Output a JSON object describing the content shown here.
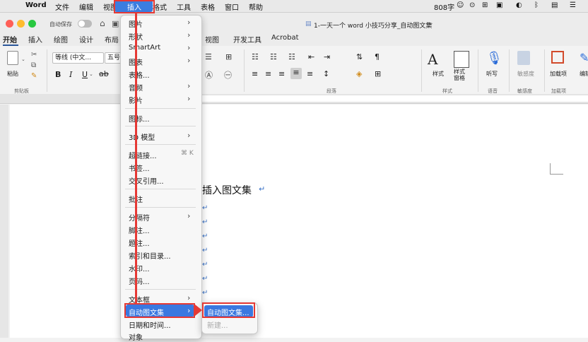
{
  "menubar": {
    "app": "Word",
    "items": [
      "文件",
      "编辑",
      "视图",
      "插入",
      "格式",
      "工具",
      "表格",
      "窗口",
      "帮助"
    ],
    "word_count": "808字"
  },
  "titlebar": {
    "autosave_label": "自动保存",
    "doc_title": "1-一天一个 word 小技巧分享_自动图文集"
  },
  "tabs": [
    "开始",
    "插入",
    "绘图",
    "设计",
    "布局",
    "视图",
    "开发工具",
    "Acrobat"
  ],
  "ribbon": {
    "paste": "粘贴",
    "clipboard_group": "剪贴板",
    "font_name": "等线 (中文...",
    "font_size": "五号",
    "paragraph_group": "段落",
    "styles": "样式",
    "styles_pane": "样式\n窗格",
    "styles_group": "样式",
    "dictate": "听写",
    "voice_group": "语音",
    "sensitivity": "敏感度",
    "sensitivity_group": "敏感度",
    "addins": "加载项",
    "addins_group": "加载项",
    "edit_partial": "编辑"
  },
  "insert_menu": {
    "items": [
      {
        "label": "图片",
        "submenu": true
      },
      {
        "label": "形状",
        "submenu": true
      },
      {
        "label": "SmartArt",
        "submenu": true
      },
      {
        "label": "图表",
        "submenu": true
      },
      {
        "label": "表格...",
        "submenu": false
      },
      {
        "label": "音频",
        "submenu": true
      },
      {
        "label": "影片",
        "submenu": true
      },
      {
        "label": "图标...",
        "submenu": false
      },
      {
        "label": "3D 模型",
        "submenu": true
      },
      {
        "label": "超链接...",
        "submenu": false,
        "shortcut": "⌘ K"
      },
      {
        "label": "书签...",
        "submenu": false
      },
      {
        "label": "交叉引用...",
        "submenu": false
      },
      {
        "label": "批注",
        "submenu": false
      },
      {
        "label": "分隔符",
        "submenu": true
      },
      {
        "label": "脚注...",
        "submenu": false
      },
      {
        "label": "题注...",
        "submenu": false
      },
      {
        "label": "索引和目录...",
        "submenu": false
      },
      {
        "label": "水印...",
        "submenu": false
      },
      {
        "label": "页码...",
        "submenu": false
      },
      {
        "label": "文本框",
        "submenu": true
      },
      {
        "label": "自动图文集",
        "submenu": true
      },
      {
        "label": "日期和时间...",
        "submenu": false
      },
      {
        "label": "对象",
        "submenu": false
      }
    ]
  },
  "submenu": {
    "autotext": "自动图文集...",
    "new": "新建..."
  },
  "document": {
    "heading": "插入图文集"
  },
  "colors": {
    "accent": "#3a78e0",
    "annotation": "#e53935",
    "ribbon_blue": "#2b579a"
  }
}
